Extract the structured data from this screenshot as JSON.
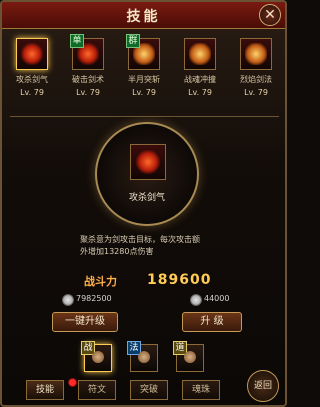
{
  "window": {
    "title": "技能"
  },
  "skills": [
    {
      "name": "攻杀剑气",
      "level": "Lv. 79",
      "tag": ""
    },
    {
      "name": "破击剑术",
      "level": "Lv. 79",
      "tag": "单"
    },
    {
      "name": "半月突斩",
      "level": "Lv. 79",
      "tag": "群"
    },
    {
      "name": "战魂冲撞",
      "level": "Lv. 79",
      "tag": ""
    },
    {
      "name": "烈焰剑法",
      "level": "Lv. 79",
      "tag": ""
    }
  ],
  "selected_skill": {
    "name": "攻杀剑气",
    "description_line1": "聚杀意为剑攻击目标，每次攻击额",
    "description_line2": "外增加13280点伤害"
  },
  "power": {
    "label": "战斗力",
    "value": "189600"
  },
  "costs": {
    "left": "7982500",
    "right": "44000"
  },
  "buttons": {
    "one_click_upgrade": "一键升级",
    "upgrade": "升 级"
  },
  "heroes": [
    {
      "tag": "战"
    },
    {
      "tag": "法"
    },
    {
      "tag": "道"
    }
  ],
  "tabs": [
    {
      "label": "技能"
    },
    {
      "label": "符文"
    },
    {
      "label": "突破"
    },
    {
      "label": "魂珠"
    }
  ],
  "back_label": "返回",
  "icons": {
    "close": "close-icon",
    "skill": "sword-skill-icon",
    "coin": "coin-icon",
    "back": "back-icon"
  }
}
